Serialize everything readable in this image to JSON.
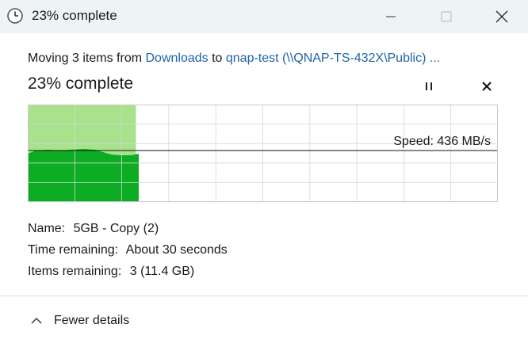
{
  "window": {
    "title": "23% complete",
    "icon": "clock-icon"
  },
  "summary": {
    "prefix": "Moving 3 items from ",
    "source": "Downloads",
    "middle": " to ",
    "destination": "qnap-test (\\\\QNAP-TS-432X\\Public) ..."
  },
  "progress": {
    "heading": "23% complete",
    "fraction": 0.23,
    "speed_label": "Speed: 436 MB/s"
  },
  "details": {
    "name_label": "Name:",
    "name_value": "5GB - Copy (2)",
    "time_label": "Time remaining:",
    "time_value": "About 30 seconds",
    "items_label": "Items remaining:",
    "items_value": "3 (11.4 GB)"
  },
  "footer": {
    "toggle_label": "Fewer details",
    "toggle_icon": "chevron-up-icon"
  },
  "colors": {
    "progress_light": "#a8e28c",
    "speed_fill": "#0cad22",
    "link": "#1f63a8",
    "titlebar": "#eef3f6"
  }
}
